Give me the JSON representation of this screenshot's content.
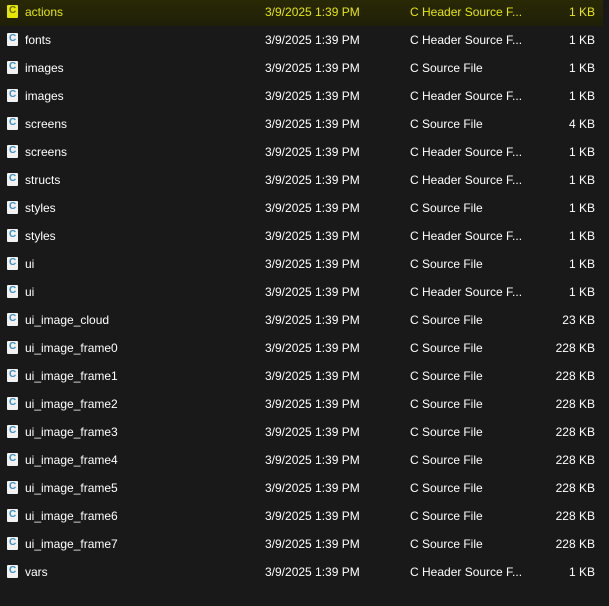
{
  "files": [
    {
      "name": "actions",
      "date": "3/9/2025 1:39 PM",
      "type": "C Header Source F...",
      "size": "1 KB",
      "selected": true
    },
    {
      "name": "fonts",
      "date": "3/9/2025 1:39 PM",
      "type": "C Header Source F...",
      "size": "1 KB"
    },
    {
      "name": "images",
      "date": "3/9/2025 1:39 PM",
      "type": "C Source File",
      "size": "1 KB"
    },
    {
      "name": "images",
      "date": "3/9/2025 1:39 PM",
      "type": "C Header Source F...",
      "size": "1 KB"
    },
    {
      "name": "screens",
      "date": "3/9/2025 1:39 PM",
      "type": "C Source File",
      "size": "4 KB"
    },
    {
      "name": "screens",
      "date": "3/9/2025 1:39 PM",
      "type": "C Header Source F...",
      "size": "1 KB"
    },
    {
      "name": "structs",
      "date": "3/9/2025 1:39 PM",
      "type": "C Header Source F...",
      "size": "1 KB"
    },
    {
      "name": "styles",
      "date": "3/9/2025 1:39 PM",
      "type": "C Source File",
      "size": "1 KB"
    },
    {
      "name": "styles",
      "date": "3/9/2025 1:39 PM",
      "type": "C Header Source F...",
      "size": "1 KB"
    },
    {
      "name": "ui",
      "date": "3/9/2025 1:39 PM",
      "type": "C Source File",
      "size": "1 KB"
    },
    {
      "name": "ui",
      "date": "3/9/2025 1:39 PM",
      "type": "C Header Source F...",
      "size": "1 KB"
    },
    {
      "name": "ui_image_cloud",
      "date": "3/9/2025 1:39 PM",
      "type": "C Source File",
      "size": "23 KB"
    },
    {
      "name": "ui_image_frame0",
      "date": "3/9/2025 1:39 PM",
      "type": "C Source File",
      "size": "228 KB"
    },
    {
      "name": "ui_image_frame1",
      "date": "3/9/2025 1:39 PM",
      "type": "C Source File",
      "size": "228 KB"
    },
    {
      "name": "ui_image_frame2",
      "date": "3/9/2025 1:39 PM",
      "type": "C Source File",
      "size": "228 KB"
    },
    {
      "name": "ui_image_frame3",
      "date": "3/9/2025 1:39 PM",
      "type": "C Source File",
      "size": "228 KB"
    },
    {
      "name": "ui_image_frame4",
      "date": "3/9/2025 1:39 PM",
      "type": "C Source File",
      "size": "228 KB"
    },
    {
      "name": "ui_image_frame5",
      "date": "3/9/2025 1:39 PM",
      "type": "C Source File",
      "size": "228 KB"
    },
    {
      "name": "ui_image_frame6",
      "date": "3/9/2025 1:39 PM",
      "type": "C Source File",
      "size": "228 KB"
    },
    {
      "name": "ui_image_frame7",
      "date": "3/9/2025 1:39 PM",
      "type": "C Source File",
      "size": "228 KB"
    },
    {
      "name": "vars",
      "date": "3/9/2025 1:39 PM",
      "type": "C Header Source F...",
      "size": "1 KB"
    }
  ],
  "icon": "c-source-file-icon",
  "colors": {
    "background": "#191919",
    "selected_text": "#e6e600"
  }
}
